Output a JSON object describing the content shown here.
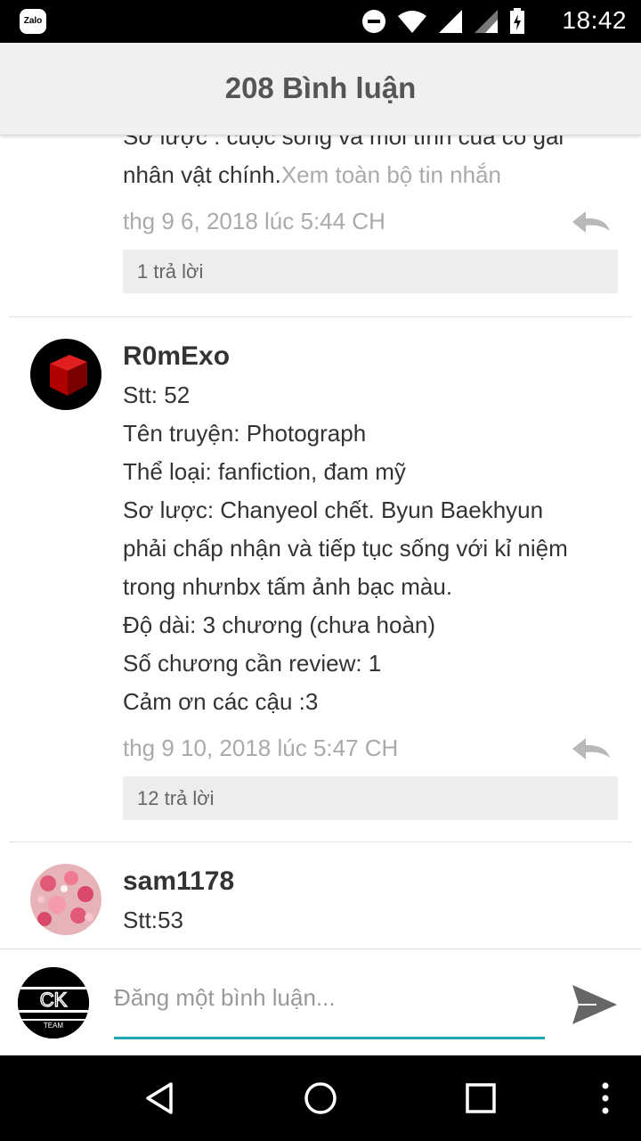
{
  "status_bar": {
    "app_icon_label": "Zalo",
    "time": "18:42"
  },
  "header": {
    "title": "208 Bình luận"
  },
  "comments": [
    {
      "lines": [
        "Sơ lược : cuộc sống và mối tình của cô gái",
        "nhân vật chính."
      ],
      "see_all": "Xem toàn bộ tin nhắn",
      "timestamp": "thg 9 6, 2018 lúc 5:44 CH",
      "replies": "1 trả lời"
    },
    {
      "author": "R0mExo",
      "lines": [
        "Stt: 52",
        "Tên truyện: Photograph",
        "Thể loại: fanfiction, đam mỹ",
        "Sơ lược: Chanyeol chết. Byun Baekhyun",
        "phải chấp nhận và tiếp tục sống với kỉ niệm",
        "trong nhưnbx tấm ảnh bạc màu.",
        "Độ dài: 3 chương (chưa hoàn)",
        "Số chương cần review: 1",
        "Cảm ơn các cậu :3"
      ],
      "timestamp": "thg 9 10, 2018 lúc 5:47 CH",
      "replies": "12 trả lời"
    },
    {
      "author": "sam1178",
      "lines": [
        "Stt:53"
      ]
    }
  ],
  "composer": {
    "placeholder": "Đăng một bình luận...",
    "avatar_text": "CK",
    "avatar_subtext": "TEAM"
  },
  "colors": {
    "accent": "#1fa8b0",
    "header_bg": "#f0f0f0",
    "reply_box_bg": "#ededed",
    "muted_text": "#aaaaaa"
  }
}
